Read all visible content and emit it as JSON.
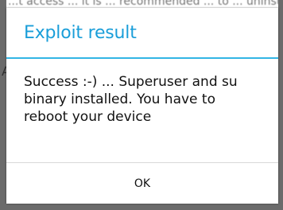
{
  "background": {
    "partial_text": "...t access ... it is ... recommended ... to ... uninstall ...",
    "partial_letter": "A"
  },
  "dialog": {
    "title": "Exploit result",
    "message": "Success :-) ... Superuser and su binary installed. You have to reboot your device",
    "ok_label": "OK",
    "title_color": "#1a9ed9",
    "divider_color": "#33b5e5"
  }
}
